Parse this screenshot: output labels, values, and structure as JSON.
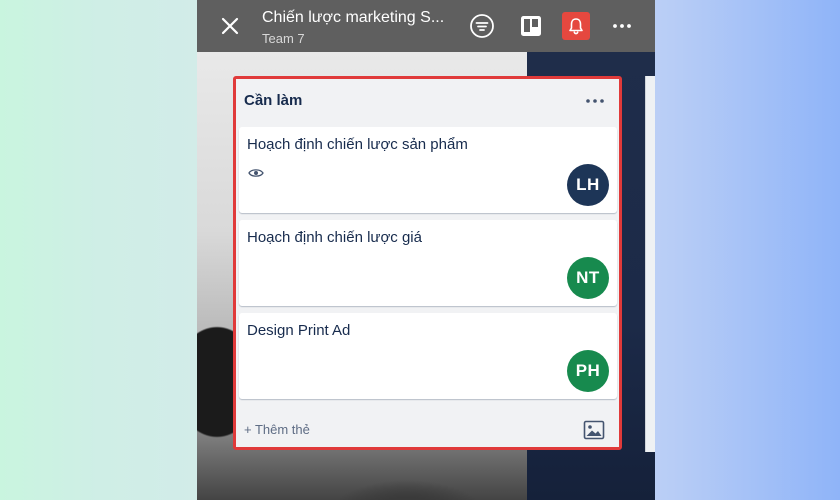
{
  "header": {
    "title": "Chiến lược marketing S...",
    "subtitle": "Team 7",
    "icons": [
      "close-icon",
      "filter-icon",
      "board-view-icon",
      "bell-icon",
      "more-icon"
    ]
  },
  "list": {
    "title": "Cần làm",
    "cards": [
      {
        "title": "Hoạch định chiến lược sản phẩm",
        "member": "LH",
        "watching": true
      },
      {
        "title": "Hoạch định chiến lược giá",
        "member": "NT",
        "watching": false
      },
      {
        "title": "Design Print Ad",
        "member": "PH",
        "watching": false
      }
    ],
    "add_card_label": "+ Thêm thẻ"
  },
  "colors": {
    "highlight_border": "#e03a3a",
    "avatar_lh": "#1d3557",
    "avatar_green": "#178a4e",
    "bell_button": "#e5483f"
  }
}
